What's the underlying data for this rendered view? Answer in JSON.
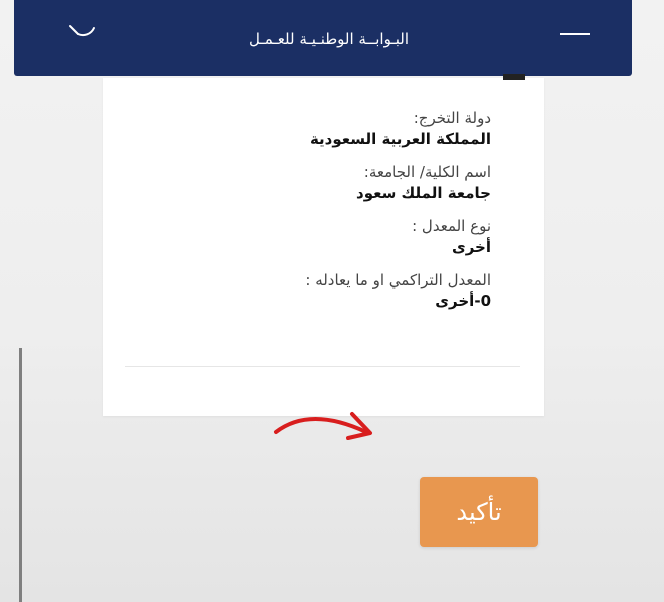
{
  "header": {
    "site_title": "البـوابــة الوطنـيـة للعـمـل"
  },
  "details": {
    "items": [
      {
        "label": "دولة التخرج:",
        "value": "المملكة العربية السعودية"
      },
      {
        "label": "اسم الكلية/ الجامعة:",
        "value": "جامعة الملك سعود"
      },
      {
        "label": "نوع المعدل :",
        "value": "أخرى"
      },
      {
        "label": "المعدل التراكمي او ما يعادله :",
        "value": "0-أخرى"
      }
    ]
  },
  "actions": {
    "confirm_label": "تأكيد"
  },
  "colors": {
    "header_bg": "#1b2f64",
    "button_bg": "#e8974f",
    "arrow": "#d81e1e"
  },
  "icons": {
    "search": "search-icon",
    "menu": "menu-icon",
    "arrow": "arrow-annotation"
  }
}
